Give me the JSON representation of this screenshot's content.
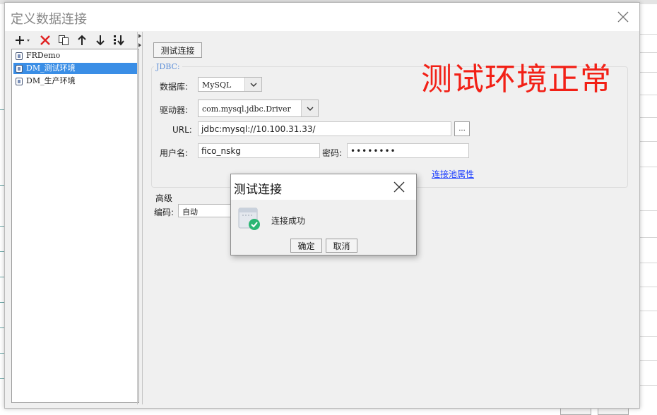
{
  "dialog": {
    "title": "定义数据连接"
  },
  "toolbar": {
    "add_icon": "plus-dropdown-icon",
    "delete_icon": "red-x-icon",
    "copy_icon": "copy-icon",
    "up_icon": "arrow-up-icon",
    "down_icon": "arrow-down-icon",
    "sort_icon": "sort-icon"
  },
  "tree": {
    "items": [
      {
        "label": "FRDemo"
      },
      {
        "label": "DM_测试环境"
      },
      {
        "label": "DM_生产环境"
      }
    ],
    "selected_index": 1
  },
  "main": {
    "test_button": "测试连接",
    "jdbc_legend": "JDBC:",
    "db_label": "数据库:",
    "db_value": "MySQL",
    "driver_label": "驱动器:",
    "driver_value": "com.mysql.jdbc.Driver",
    "url_label": "URL:",
    "url_value": "jdbc:mysql://10.100.31.33/",
    "url_browse": "...",
    "user_label": "用户名:",
    "user_value": "fico_nskg",
    "password_label": "密码:",
    "password_value": "••••••••",
    "pool_link": "连接池属性",
    "advanced_label": "高级",
    "encoding_label": "编码:",
    "encoding_value": "自动",
    "annotation": "测试环境正常",
    "annotation_color": "#f22016"
  },
  "modal": {
    "title": "测试连接",
    "message": "连接成功",
    "ok": "确定",
    "cancel": "取消",
    "success_color": "#2bb673"
  }
}
